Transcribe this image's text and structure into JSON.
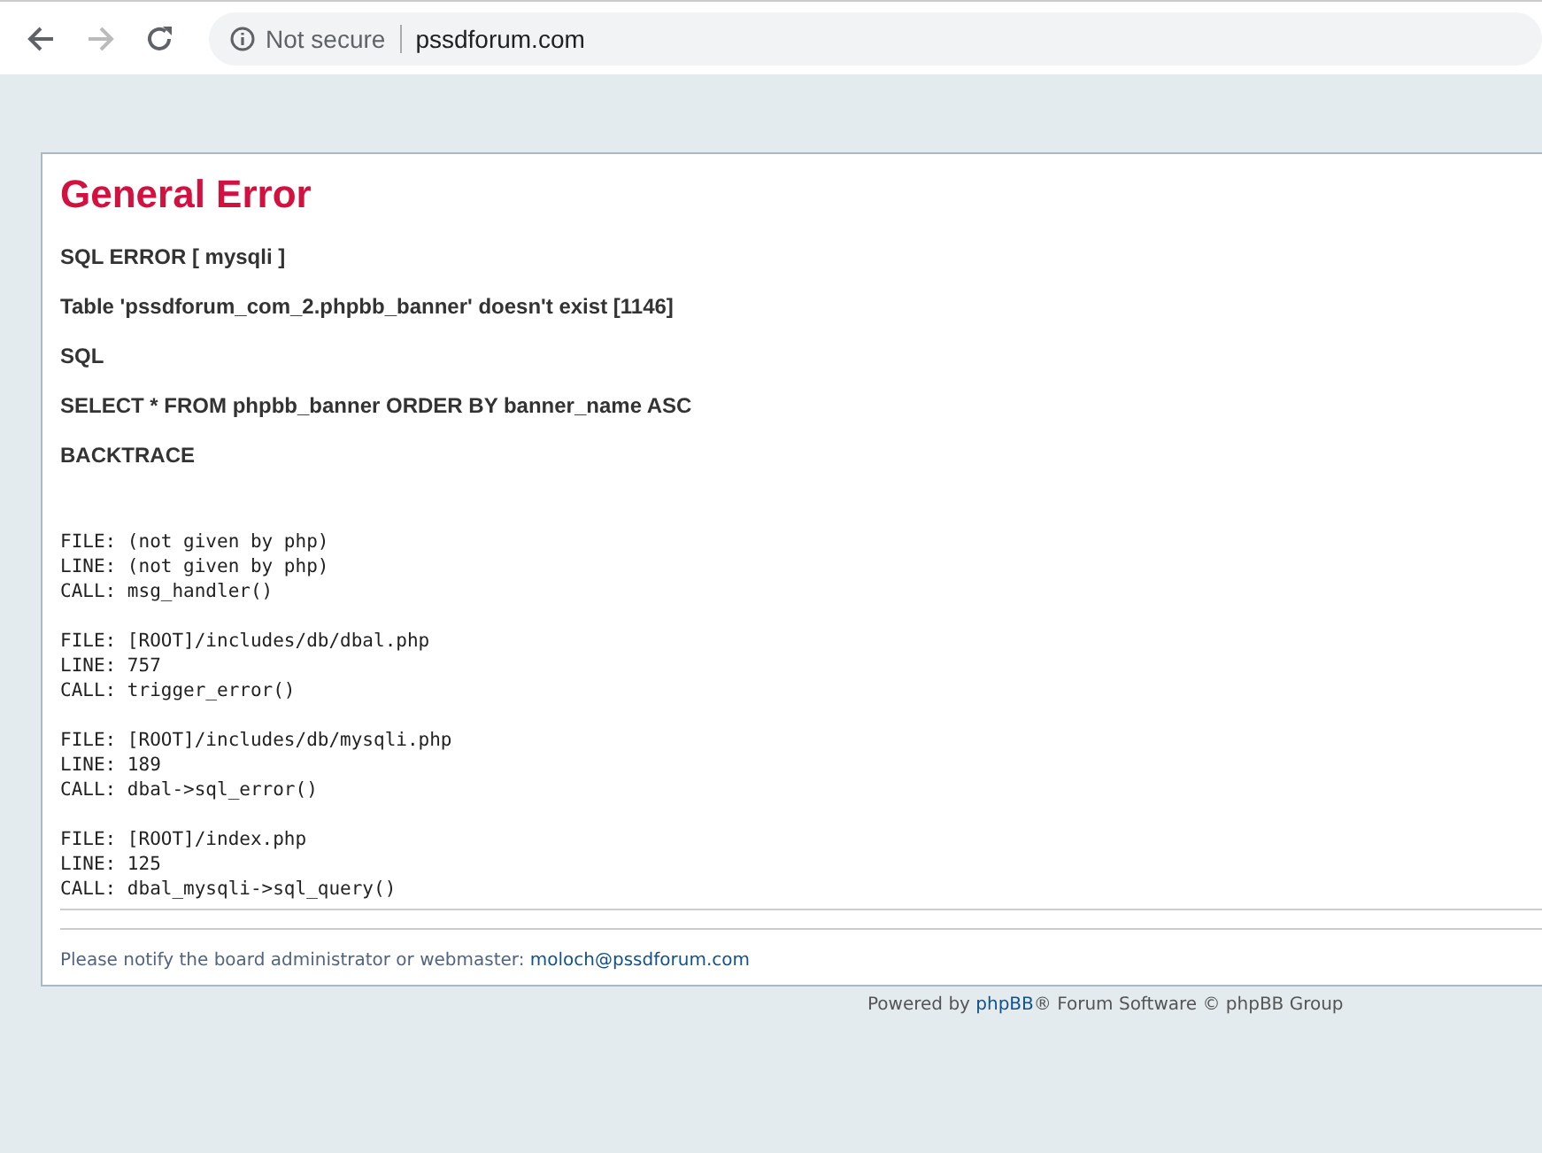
{
  "browser": {
    "security": "Not secure",
    "url": "pssdforum.com"
  },
  "error": {
    "title": "General Error",
    "messages": [
      "SQL ERROR [ mysqli ]",
      "Table 'pssdforum_com_2.phpbb_banner' doesn't exist [1146]",
      "SQL",
      "SELECT * FROM phpbb_banner ORDER BY banner_name ASC",
      "BACKTRACE"
    ],
    "backtrace": [
      {
        "lines": [
          "FILE: (not given by php)",
          "LINE: (not given by php)",
          "CALL: msg_handler()"
        ]
      },
      {
        "lines": [
          "FILE: [ROOT]/includes/db/dbal.php",
          "LINE: 757",
          "CALL: trigger_error()"
        ]
      },
      {
        "lines": [
          "FILE: [ROOT]/includes/db/mysqli.php",
          "LINE: 189",
          "CALL: dbal->sql_error()"
        ]
      },
      {
        "lines": [
          "FILE: [ROOT]/index.php",
          "LINE: 125",
          "CALL: dbal_mysqli->sql_query()"
        ]
      }
    ],
    "notice": {
      "text": "Please notify the board administrator or webmaster:",
      "email": "moloch@pssdforum.com"
    }
  },
  "footer": {
    "before": "Powered by",
    "link": "phpBB",
    "after": "® Forum Software © phpBB Group"
  }
}
